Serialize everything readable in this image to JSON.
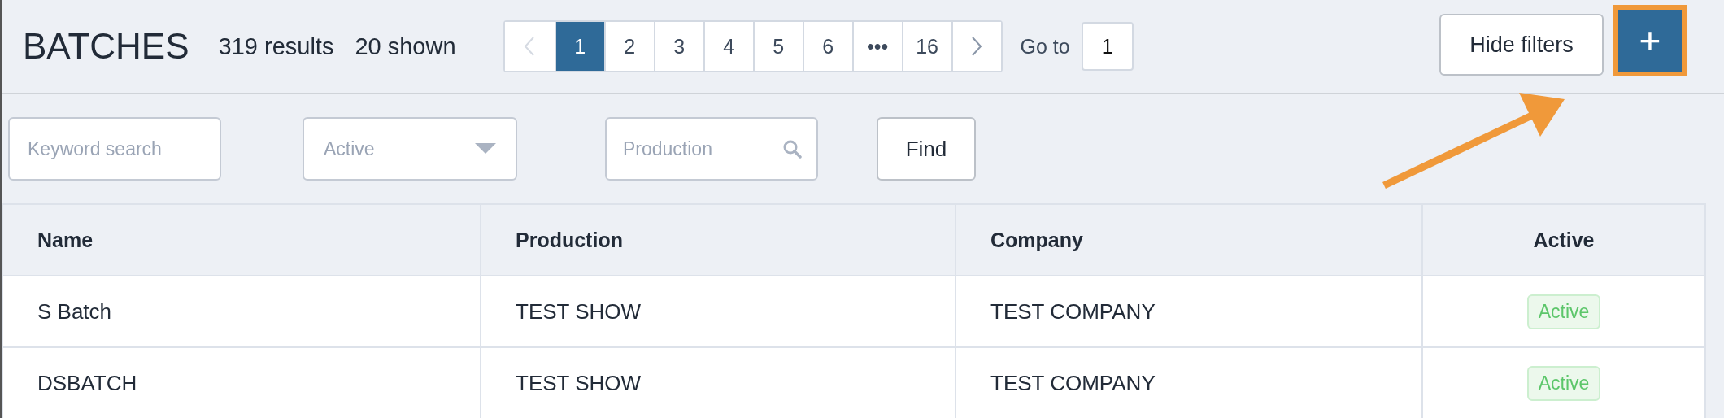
{
  "header": {
    "title": "BATCHES",
    "results": "319 results",
    "shown": "20 shown"
  },
  "pagination": {
    "prev_disabled": true,
    "next_disabled": false,
    "pages": [
      {
        "label": "1",
        "selected": true
      },
      {
        "label": "2",
        "selected": false
      },
      {
        "label": "3",
        "selected": false
      },
      {
        "label": "4",
        "selected": false
      },
      {
        "label": "5",
        "selected": false
      },
      {
        "label": "6",
        "selected": false
      },
      {
        "label": "•••",
        "selected": false
      },
      {
        "label": "16",
        "selected": false
      }
    ],
    "goto_label": "Go to",
    "goto_value": "1"
  },
  "hide_filters_button": "Hide filters",
  "add_button": {
    "label": "+",
    "highlighted": true
  },
  "filters": {
    "keyword_placeholder": "Keyword search",
    "status_placeholder": "Active",
    "production_placeholder": "Production",
    "find_button": "Find"
  },
  "table": {
    "columns": [
      "Name",
      "Production",
      "Company",
      "Active"
    ],
    "rows": [
      {
        "name": "S Batch",
        "production": "TEST SHOW",
        "company": "TEST COMPANY",
        "active": "Active"
      },
      {
        "name": "DSBATCH",
        "production": "TEST SHOW",
        "company": "TEST COMPANY",
        "active": "Active"
      }
    ]
  }
}
